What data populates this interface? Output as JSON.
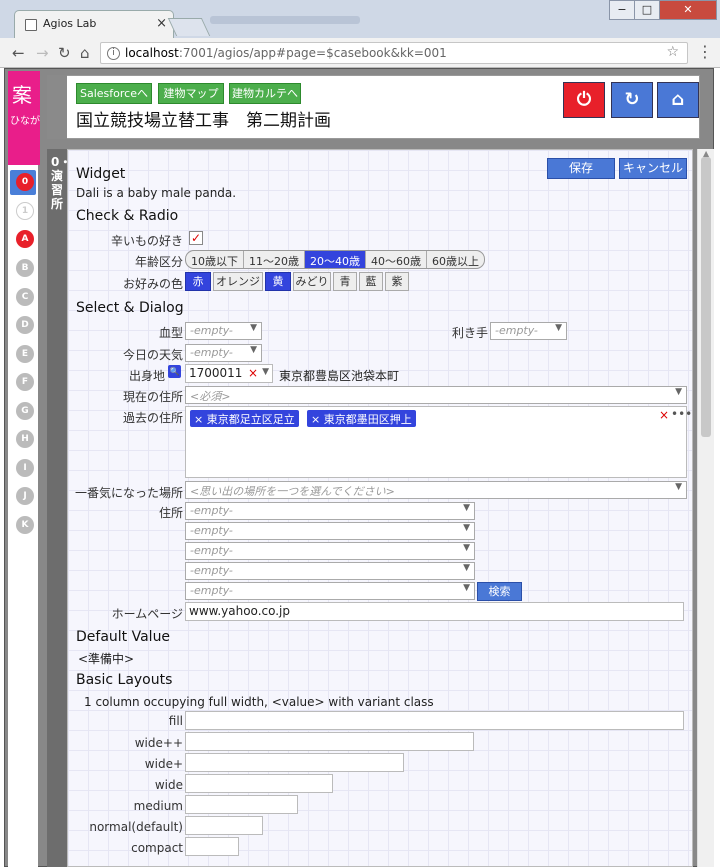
{
  "browser": {
    "tab_title": "Agios Lab",
    "url_host": "localhost",
    "url_rest": ":7001/agios/app#page=$casebook&kk=001"
  },
  "sidebar": {
    "pink_big": "案",
    "pink_small": "ひなが",
    "items": [
      "0",
      "1",
      "A",
      "B",
      "C",
      "D",
      "E",
      "F",
      "G",
      "H",
      "I",
      "J",
      "K"
    ]
  },
  "header": {
    "links": [
      "Salesforceへ",
      "建物マップへ",
      "建物カルテへ"
    ],
    "title": "国立競技場立替工事　第二期計画",
    "colors": {
      "power": "#e8202a",
      "reload": "#4a78d6",
      "home": "#4a78d6"
    }
  },
  "leftbar": {
    "label": "0・演習所"
  },
  "actions": {
    "save": "保存",
    "cancel": "キャンセル"
  },
  "widget": {
    "title": "Widget",
    "desc": "Dali is a baby male panda."
  },
  "check_radio": {
    "title": "Check & Radio",
    "spicy_label": "辛いもの好き",
    "spicy_checked": "✓",
    "age_label": "年齢区分",
    "ages": [
      "10歳以下",
      "11～20歳",
      "20～40歳",
      "40～60歳",
      "60歳以上"
    ],
    "age_selected": "20～40歳",
    "color_label": "お好みの色",
    "colors": [
      "赤",
      "オレンジ",
      "黄",
      "みどり",
      "青",
      "藍",
      "紫"
    ],
    "colors_selected": [
      "赤",
      "黄"
    ]
  },
  "select_dialog": {
    "title": "Select & Dialog",
    "blood_label": "血型",
    "blood_value": "-empty-",
    "hand_label": "利き手",
    "hand_value": "-empty-",
    "weather_label": "今日の天気",
    "weather_value": "-empty-",
    "birth_label": "出身地",
    "birth_zip": "1700011",
    "birth_address": "東京都豊島区池袋本町",
    "current_label": "現在の住所",
    "current_placeholder": "<必須>",
    "past_label": "過去の住所",
    "past_tags": [
      "× 東京都足立区足立",
      "× 東京都墨田区押上"
    ],
    "fav_label": "一番気になった場所",
    "fav_placeholder": "<思い出の場所を一つを選んでください>",
    "addr_label": "住所",
    "addr_values": [
      "-empty-",
      "-empty-",
      "-empty-",
      "-empty-",
      "-empty-"
    ],
    "search_button": "検索",
    "home_label": "ホームページ",
    "home_value": "www.yahoo.co.jp"
  },
  "default_value": {
    "title": "Default Value",
    "text": "<準備中>"
  },
  "basic_layouts": {
    "title": "Basic Layouts",
    "desc": "1 column occupying full width, <value> with variant class",
    "rows": [
      "fill",
      "wide++",
      "wide+",
      "wide",
      "medium",
      "normal(default)",
      "compact"
    ]
  }
}
